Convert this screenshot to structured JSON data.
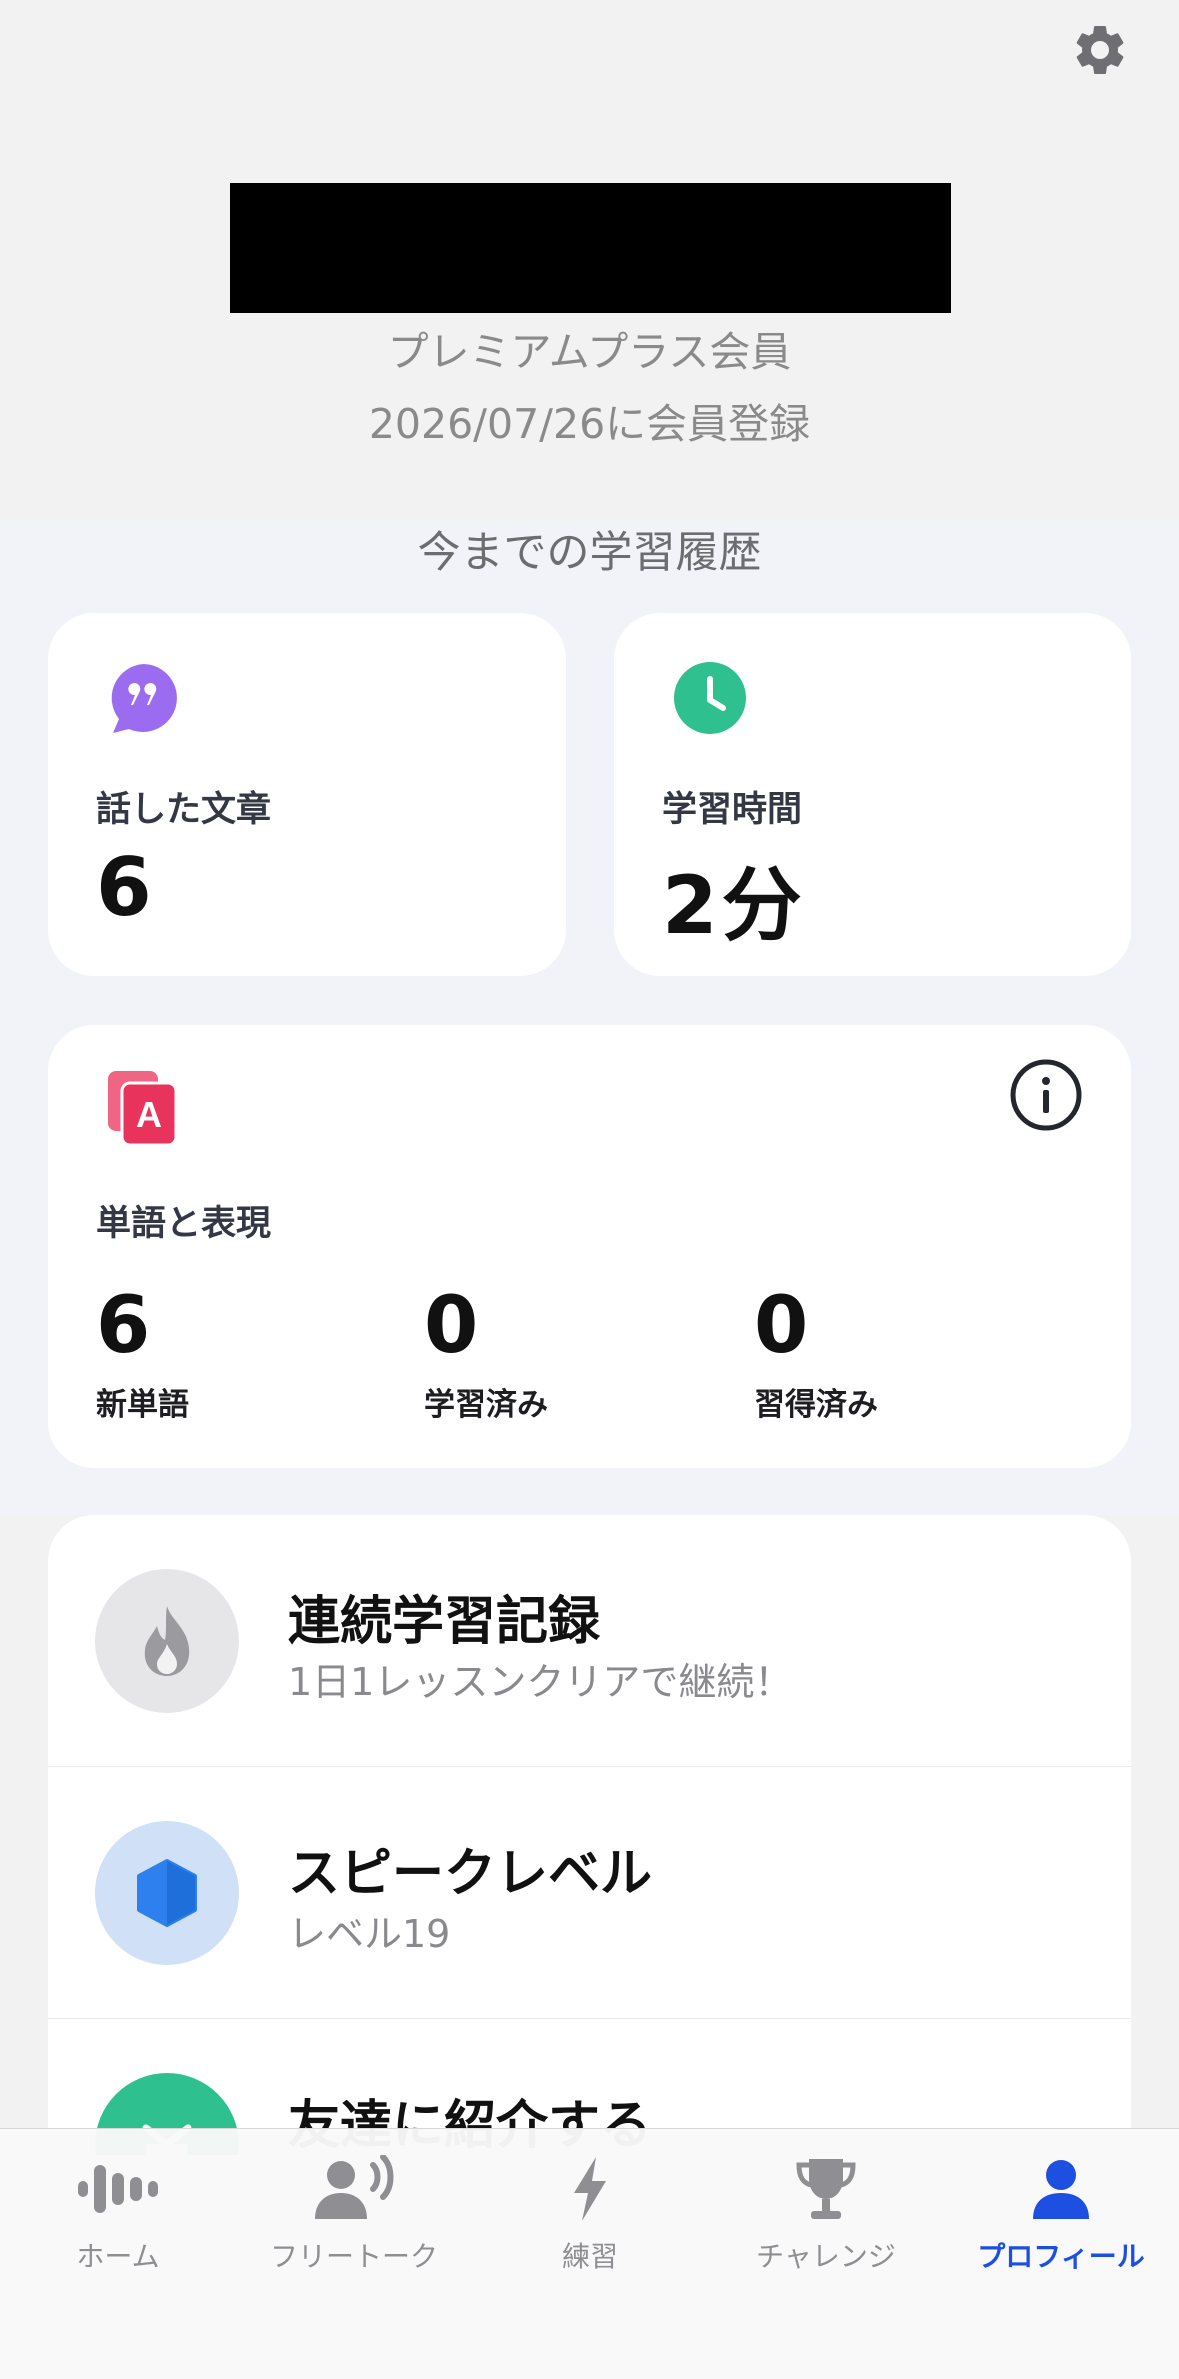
{
  "profile": {
    "membership": "プレミアムプラス会員",
    "joined": "2026/07/26に会員登録"
  },
  "history": {
    "title": "今までの学習履歴",
    "sentences": {
      "label": "話した文章",
      "value": "6",
      "icon": "quote-bubble-icon",
      "color": "#9b6cf0"
    },
    "time": {
      "label": "学習時間",
      "value": "2分",
      "icon": "clock-icon",
      "color": "#2ec08e"
    },
    "vocab": {
      "label": "単語と表現",
      "icon": "vocab-cards-icon",
      "color": "#ef4a6e",
      "stats": [
        {
          "value": "6",
          "label": "新単語"
        },
        {
          "value": "0",
          "label": "学習済み"
        },
        {
          "value": "0",
          "label": "習得済み"
        }
      ]
    }
  },
  "rows": [
    {
      "title": "連続学習記録",
      "subtitle": "1日1レッスンクリアで継続！",
      "icon": "flame-icon"
    },
    {
      "title": "スピークレベル",
      "subtitle": "レベル19",
      "icon": "hexagon-icon"
    },
    {
      "title": "友達に紹介する",
      "subtitle": "",
      "icon": "gift-icon"
    }
  ],
  "tabs": [
    {
      "label": "ホーム",
      "icon": "waveform-icon",
      "active": false
    },
    {
      "label": "フリートーク",
      "icon": "speaking-person-icon",
      "active": false
    },
    {
      "label": "練習",
      "icon": "lightning-icon",
      "active": false
    },
    {
      "label": "チャレンジ",
      "icon": "trophy-icon",
      "active": false
    },
    {
      "label": "プロフィール",
      "icon": "person-icon",
      "active": true
    }
  ],
  "colors": {
    "accent": "#1d4fe0",
    "inactive": "#8e8e93"
  }
}
